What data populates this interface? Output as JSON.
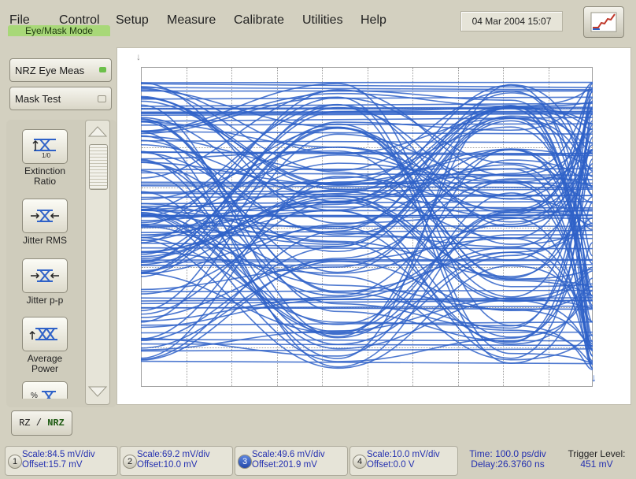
{
  "menu": {
    "items": [
      "File",
      "Control",
      "Setup",
      "Measure",
      "Calibrate",
      "Utilities",
      "Help"
    ]
  },
  "datetime": "04 Mar 2004   15:07",
  "mode_label": "Eye/Mask Mode",
  "modes": {
    "nrz_eye": "NRZ Eye Meas",
    "mask_test": "Mask Test"
  },
  "measurements": [
    {
      "label": "Extinction Ratio",
      "icon": "extinction-ratio-icon"
    },
    {
      "label": "Jitter RMS",
      "icon": "jitter-rms-icon"
    },
    {
      "label": "Jitter p-p",
      "icon": "jitter-pp-icon"
    },
    {
      "label": "Average Power",
      "icon": "average-power-icon"
    }
  ],
  "rz_nrz": {
    "rz": "RZ",
    "sep": "/",
    "nrz": "NRZ"
  },
  "channels": [
    {
      "num": "1",
      "scale": "Scale:84.5 mV/div",
      "offset": "Offset:15.7 mV"
    },
    {
      "num": "2",
      "scale": "Scale:69.2 mV/div",
      "offset": "Offset:10.0 mV"
    },
    {
      "num": "3",
      "scale": "Scale:49.6 mV/div",
      "offset": "Offset:201.9 mV"
    },
    {
      "num": "4",
      "scale": "Scale:10.0 mV/div",
      "offset": "Offset:0.0 V"
    }
  ],
  "timebase": {
    "time": "Time:  100.0 ps/div",
    "delay": "Delay:26.3760 ns"
  },
  "trigger": {
    "label": "Trigger Level:",
    "value": "451 mV"
  },
  "colors": {
    "trace": "#2f62c8",
    "mode_green": "#a8d878",
    "active_channel": "#2f5fc8"
  }
}
